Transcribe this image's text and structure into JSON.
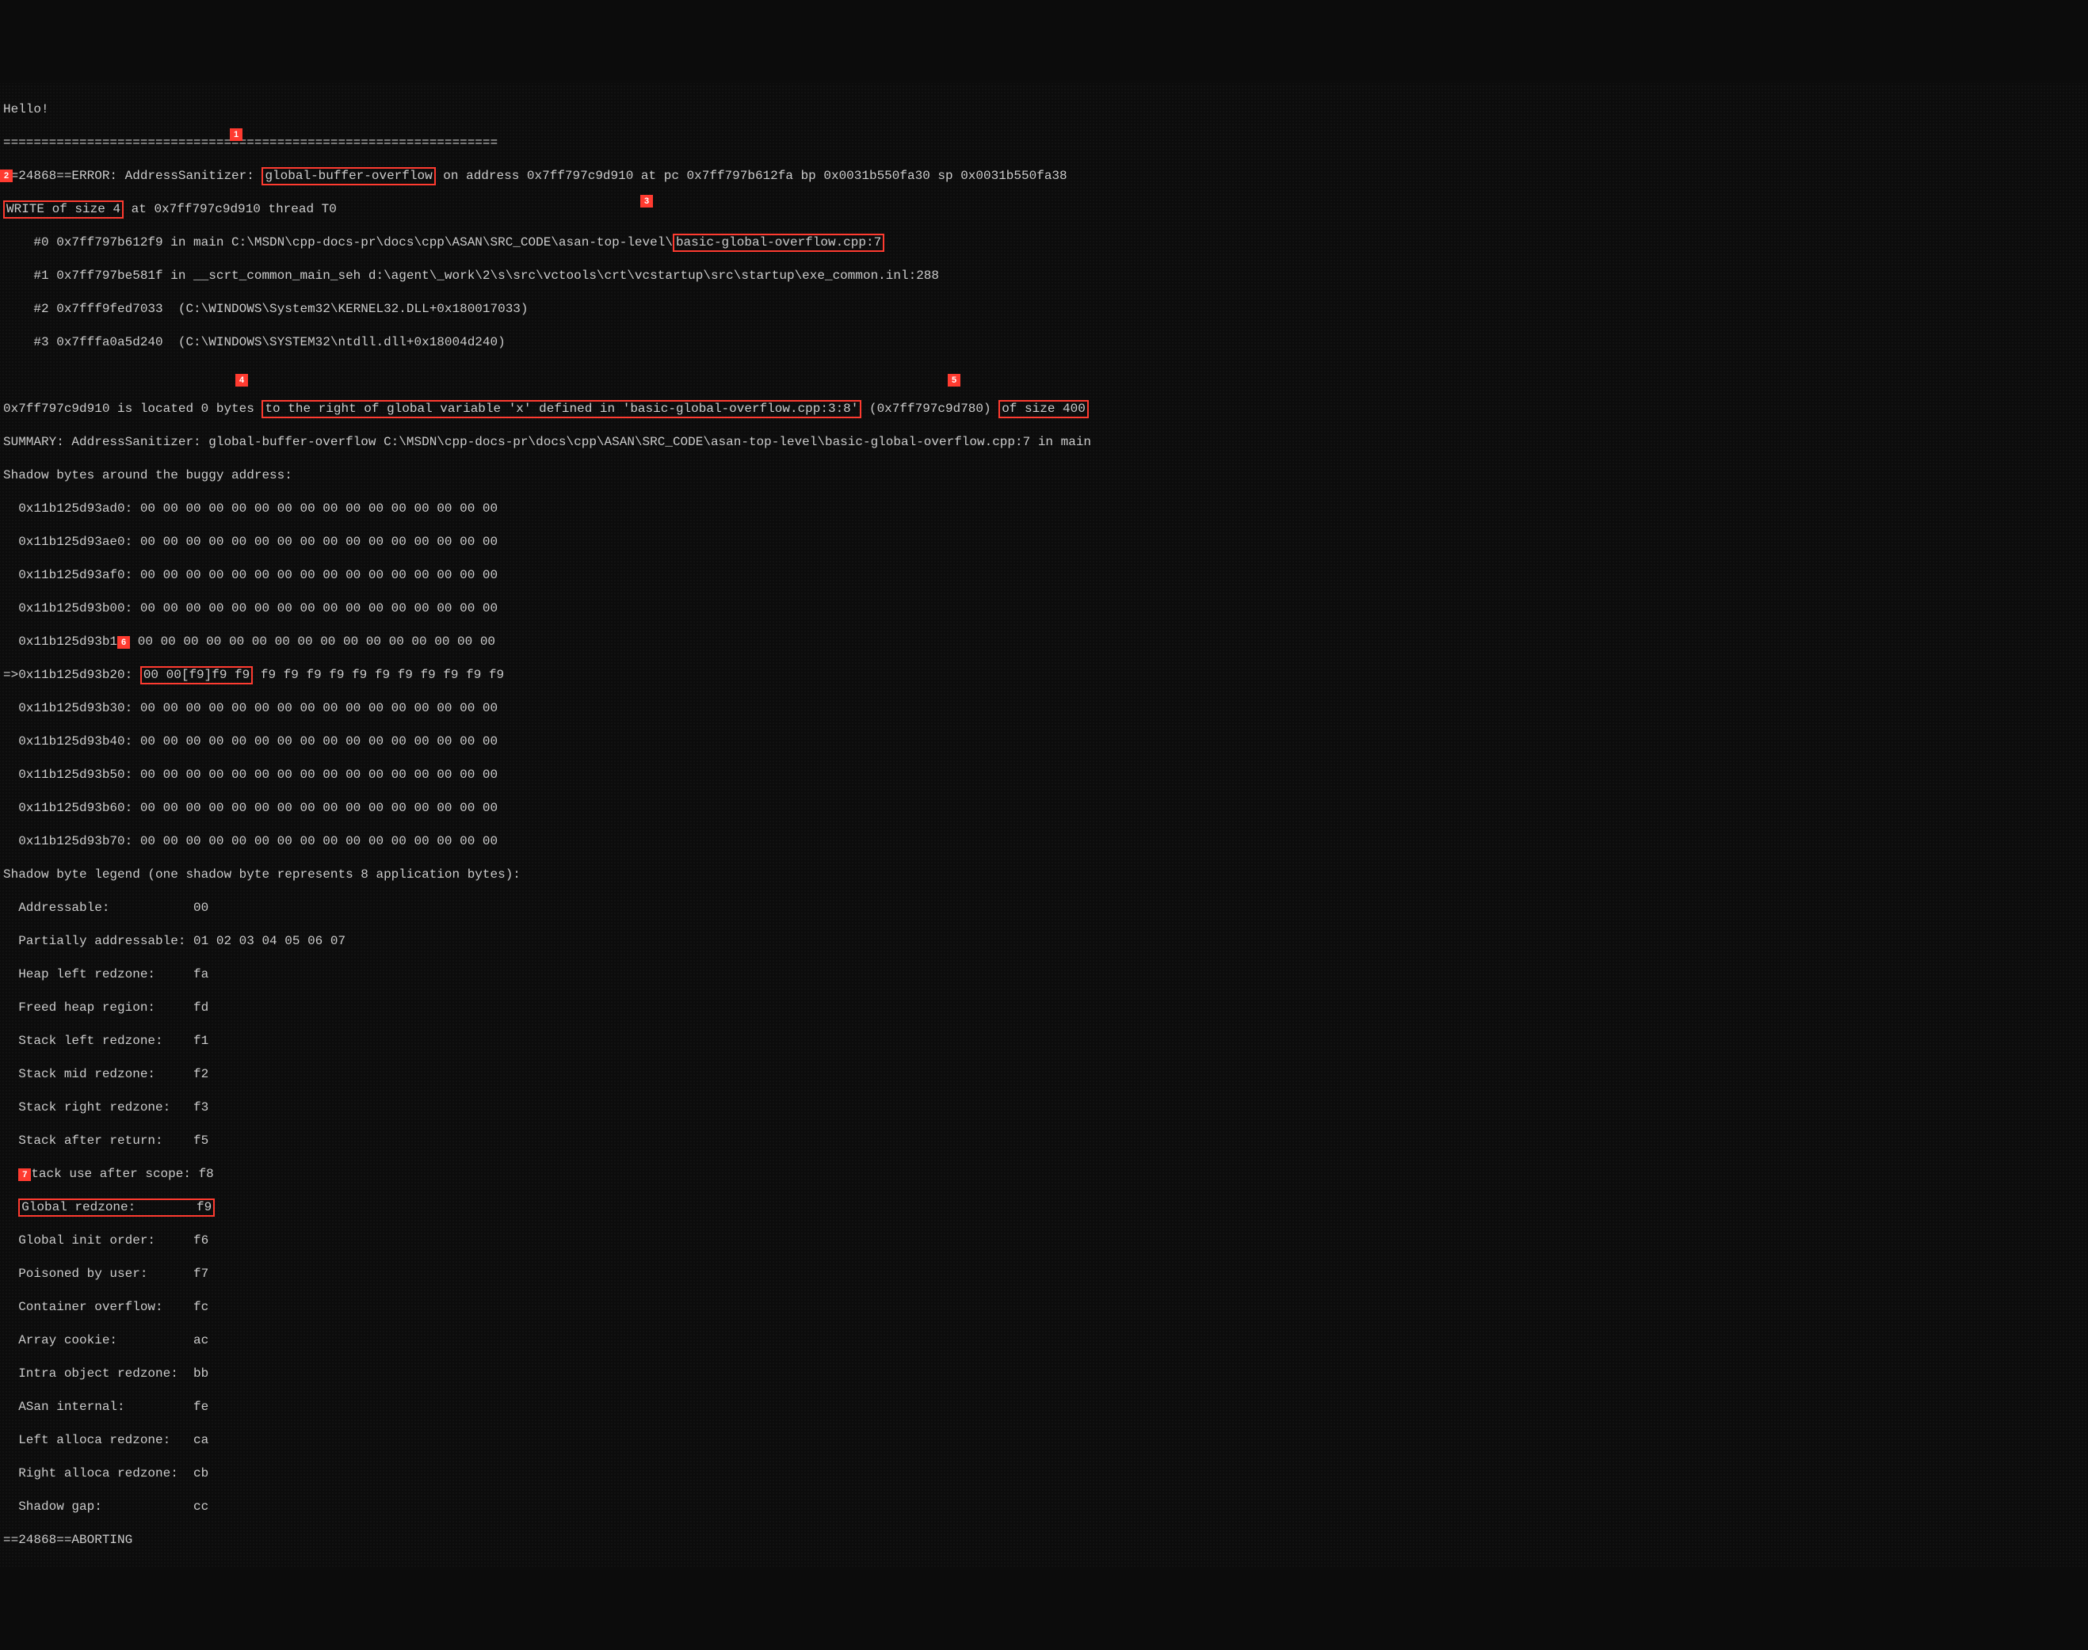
{
  "greeting": "Hello!",
  "separator": "=================================================================",
  "callouts": {
    "c1": "1",
    "c2": "2",
    "c3": "3",
    "c4": "4",
    "c5": "5",
    "c6": "6",
    "c7": "7"
  },
  "err": {
    "pre": "==24868==ERROR: AddressSanitizer: ",
    "box": "global-buffer-overflow",
    "post": " on address 0x7ff797c9d910 at pc 0x7ff797b612fa bp 0x0031b550fa30 sp 0x0031b550fa38"
  },
  "write": {
    "box": "WRITE of size 4",
    "post": " at 0x7ff797c9d910 thread T0"
  },
  "frame0": {
    "pre": "    #0 0x7ff797b612f9 in main C:\\MSDN\\cpp-docs-pr\\docs\\cpp\\ASAN\\SRC_CODE\\asan-top-level\\",
    "box": "basic-global-overflow.cpp:7"
  },
  "frame1": "    #1 0x7ff797be581f in __scrt_common_main_seh d:\\agent\\_work\\2\\s\\src\\vctools\\crt\\vcstartup\\src\\startup\\exe_common.inl:288",
  "frame2": "    #2 0x7fff9fed7033  (C:\\WINDOWS\\System32\\KERNEL32.DLL+0x180017033)",
  "frame3": "    #3 0x7fffa0a5d240  (C:\\WINDOWS\\SYSTEM32\\ntdll.dll+0x18004d240)",
  "loc": {
    "pre": "0x7ff797c9d910 is located 0 bytes ",
    "box4": "to the right of global variable 'x' defined in 'basic-global-overflow.cpp:3:8'",
    "mid": " (0x7ff797c9d780) ",
    "box5": "of size 400"
  },
  "summary": "SUMMARY: AddressSanitizer: global-buffer-overflow C:\\MSDN\\cpp-docs-pr\\docs\\cpp\\ASAN\\SRC_CODE\\asan-top-level\\basic-global-overflow.cpp:7 in main",
  "shadowHeader": "Shadow bytes around the buggy address:",
  "shadow": [
    "  0x11b125d93ad0: 00 00 00 00 00 00 00 00 00 00 00 00 00 00 00 00",
    "  0x11b125d93ae0: 00 00 00 00 00 00 00 00 00 00 00 00 00 00 00 00",
    "  0x11b125d93af0: 00 00 00 00 00 00 00 00 00 00 00 00 00 00 00 00",
    "  0x11b125d93b00: 00 00 00 00 00 00 00 00 00 00 00 00 00 00 00 00"
  ],
  "shadow_b10": {
    "pre": "  0x11b125d93b1",
    "hidden": "0:",
    "post": " 00 00 00 00 00 00 00 00 00 00 00 00 00 00 00 00"
  },
  "shadow_ptr": {
    "pre": "=>0x11b125d93b20: ",
    "box": "00 00[f9]f9 f9",
    "post": " f9 f9 f9 f9 f9 f9 f9 f9 f9 f9 f9"
  },
  "shadow2": [
    "  0x11b125d93b30: 00 00 00 00 00 00 00 00 00 00 00 00 00 00 00 00",
    "  0x11b125d93b40: 00 00 00 00 00 00 00 00 00 00 00 00 00 00 00 00",
    "  0x11b125d93b50: 00 00 00 00 00 00 00 00 00 00 00 00 00 00 00 00",
    "  0x11b125d93b60: 00 00 00 00 00 00 00 00 00 00 00 00 00 00 00 00",
    "  0x11b125d93b70: 00 00 00 00 00 00 00 00 00 00 00 00 00 00 00 00"
  ],
  "legendHeader": "Shadow byte legend (one shadow byte represents 8 application bytes):",
  "legend1": [
    "  Addressable:           00",
    "  Partially addressable: 01 02 03 04 05 06 07",
    "  Heap left redzone:     fa",
    "  Freed heap region:     fd",
    "  Stack left redzone:    f1",
    "  Stack mid redzone:     f2",
    "  Stack right redzone:   f3",
    "  Stack after return:    f5"
  ],
  "legend_hidden": {
    "pre": "  ",
    "hidden": "S",
    "post": "tack use after scope: f8"
  },
  "globalRedzone": {
    "box": "Global redzone:        f9",
    "pre": "  "
  },
  "legend2": [
    "  Global init order:     f6",
    "  Poisoned by user:      f7",
    "  Container overflow:    fc",
    "  Array cookie:          ac",
    "  Intra object redzone:  bb",
    "  ASan internal:         fe",
    "  Left alloca redzone:   ca",
    "  Right alloca redzone:  cb",
    "  Shadow gap:            cc"
  ],
  "abort": "==24868==ABORTING"
}
